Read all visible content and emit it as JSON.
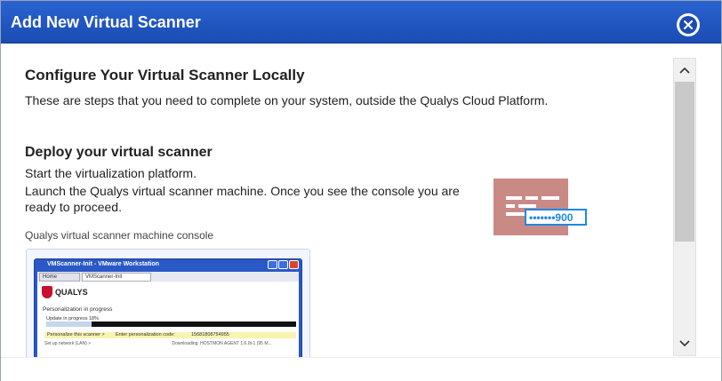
{
  "dialog": {
    "title": "Add New Virtual Scanner",
    "close_icon": "close-icon"
  },
  "content": {
    "heading": "Configure Your Virtual Scanner Locally",
    "description": "These are steps that you need to complete on your system, outside the Qualys Cloud Platform.",
    "section_heading": "Deploy your virtual scanner",
    "step1": "Start the virtualization platform.",
    "step2": "Launch the Qualys virtual scanner machine. Once you see the console you are ready to proceed.",
    "caption": "Qualys virtual scanner machine console",
    "illustration": {
      "icon": "console-code-icon",
      "code_text": "•••••••900",
      "colors": {
        "card": "#c98a86",
        "badge_border": "#1e88e5",
        "badge_text": "#1e88e5"
      }
    }
  },
  "console_screenshot": {
    "window_title": "VMScanner-Init - VMware Workstation",
    "tab_home": "Home",
    "tab_active": "VMScanner-Init",
    "brand": "QUALYS",
    "status": "Personalization in progress",
    "progress_label": "Update in progress 18%",
    "progress": 0.18,
    "row_label": "Personalize this scanner >",
    "row_field": "Enter personalization code:",
    "row_value": "15681808754955",
    "next_row_left": "Set up network (LAN) >",
    "next_row_right": "Downloading: HOSTMON AGENT 1.6.0t-1 (95 M..."
  },
  "scrollbar": {
    "up_icon": "chevron-up-icon",
    "down_icon": "chevron-down-icon"
  },
  "colors": {
    "titlebar": "#1f55c2",
    "accent": "#1e88e5"
  }
}
